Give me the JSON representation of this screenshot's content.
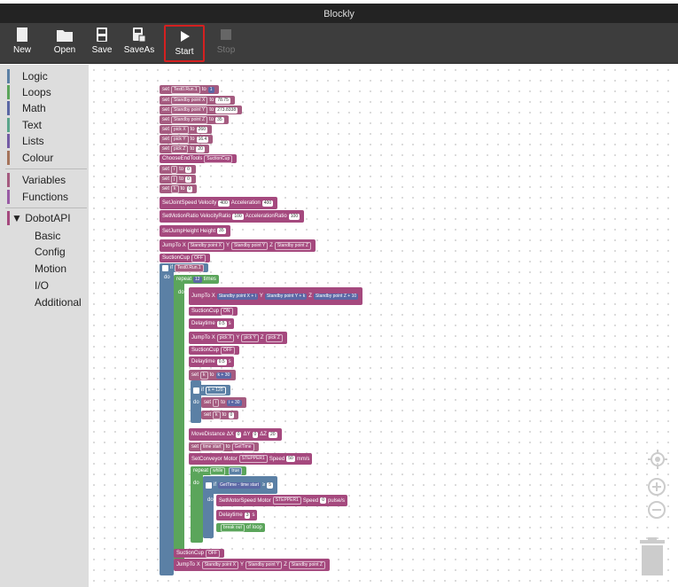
{
  "window": {
    "title": "Blockly"
  },
  "toolbar": {
    "new": "New",
    "open": "Open",
    "save": "Save",
    "saveas": "SaveAs",
    "start": "Start",
    "stop": "Stop"
  },
  "sidebar": {
    "logic": "Logic",
    "loops": "Loops",
    "math": "Math",
    "text": "Text",
    "lists": "Lists",
    "colour": "Colour",
    "variables": "Variables",
    "functions": "Functions",
    "dobot": "▼ DobotAPI",
    "sub": {
      "basic": "Basic",
      "config": "Config",
      "motion": "Motion",
      "io": "I/O",
      "additional": "Additional"
    }
  },
  "colors": {
    "procedure": "#a5497e",
    "variable": "#a55b80",
    "math": "#5b67a5",
    "logic": "#5b80a5",
    "loops": "#5ba55b",
    "sidebar_logic": "#5b80a5",
    "sidebar_loops": "#5ba55b",
    "sidebar_math": "#5b67a5",
    "sidebar_text": "#5ba58c",
    "sidebar_lists": "#745ba5",
    "sidebar_colour": "#a5745b",
    "sidebar_variables": "#a55b80",
    "sidebar_functions": "#995ba5",
    "sidebar_dobot": "#a5497e"
  },
  "blocks": {
    "b1": {
      "set": "set",
      "var": "Test0.Run.1",
      "to": "to",
      "val": "1"
    },
    "b2": {
      "set": "set",
      "var": "Standby point X",
      "to": "to",
      "val": "78.75"
    },
    "b3": {
      "set": "set",
      "var": "Standby point Y",
      "to": "to",
      "val": "273.8338"
    },
    "b4": {
      "set": "set",
      "var": "Standby point Z",
      "to": "to",
      "val": "35"
    },
    "b5": {
      "set": "set",
      "var": "pick X",
      "to": "to",
      "val": "260"
    },
    "b6": {
      "set": "set",
      "var": "pick Y",
      "to": "to",
      "val": "16.4"
    },
    "b7": {
      "set": "set",
      "var": "pick Z",
      "to": "to",
      "val": "20"
    },
    "b8": {
      "label": "ChooseEndTools",
      "val": "SuctionCup"
    },
    "b9": {
      "set": "set",
      "var": "i",
      "to": "to",
      "val": "0"
    },
    "b10": {
      "set": "set",
      "var": "j",
      "to": "to",
      "val": "0"
    },
    "b11": {
      "set": "set",
      "var": "k",
      "to": "to",
      "val": "0"
    },
    "b12": {
      "label": "SetJointSpeed",
      "a": "Velocity",
      "av": "400",
      "b": "Acceleration",
      "bv": "400"
    },
    "b13": {
      "label": "SetMotionRatio",
      "a": "VelocityRatio",
      "av": "100",
      "b": "AccelerationRatio",
      "bv": "100"
    },
    "b14": {
      "label": "SetJumpHeight",
      "a": "Height",
      "av": "35"
    },
    "b15": {
      "label": "JumpTo",
      "x": "X",
      "xv": "Standby point X",
      "y": "Y",
      "yv": "Standby point Y",
      "z": "Z",
      "zv": "Standby point Z"
    },
    "b16": {
      "label": "SuctionCup",
      "val": "OFF"
    },
    "if1": {
      "if": "if",
      "cond": "Test0.Run.1",
      "do": "do"
    },
    "rep": {
      "repeat": "repeat",
      "count": "12",
      "times": "times",
      "do": "do"
    },
    "j2": {
      "label": "JumpTo",
      "x": "X",
      "xv": "Standby point X",
      "op1": "+",
      "v1": "i",
      "y": "Y",
      "yv": "Standby point Y",
      "op2": "+",
      "v2": "k",
      "z": "Z",
      "zv": "Standby point Z",
      "op3": "+",
      "v3": "10"
    },
    "sc1": {
      "label": "SuctionCup",
      "val": "ON"
    },
    "d1": {
      "label": "Delaytime",
      "val": "0.5",
      "unit": "s"
    },
    "j3": {
      "label": "JumpTo",
      "x": "X",
      "xv": "pick X",
      "y": "Y",
      "yv": "pick Y",
      "z": "Z",
      "zv": "pick Z"
    },
    "sc2": {
      "label": "SuctionCup",
      "val": "OFF"
    },
    "d2": {
      "label": "Delaytime",
      "val": "0.5",
      "unit": "s"
    },
    "sk": {
      "set": "set",
      "var": "k",
      "to": "to",
      "a": "k",
      "op": "+",
      "b": "30"
    },
    "if2": {
      "if": "if",
      "a": "k",
      "op": "=",
      "b": "120",
      "do": "do"
    },
    "si": {
      "set": "set",
      "var": "i",
      "to": "to",
      "a": "i",
      "op": "+",
      "b": "30"
    },
    "sk0": {
      "set": "set",
      "var": "k",
      "to": "to",
      "val": "0"
    },
    "md": {
      "label": "MoveDistance",
      "dx": "ΔX",
      "dxv": "0",
      "dy": "ΔY",
      "dyv": "0",
      "dz": "ΔZ",
      "dzv": "20"
    },
    "st": {
      "set": "set",
      "var": "time start",
      "to": "to",
      "val": "GetTime"
    },
    "cv": {
      "label": "SetConveyor",
      "motor": "Motor",
      "motorv": "STEPPER1",
      "speed": "Speed",
      "speedv": "50",
      "unit": "mm/s"
    },
    "rw": {
      "repeat": "repeat",
      "mode": "while",
      "val": "true",
      "do": "do"
    },
    "if3": {
      "if": "if",
      "a": "GetTime",
      "op": "-",
      "b": "time start",
      "op2": "≥",
      "c": "5",
      "do": "do"
    },
    "ms": {
      "label": "SetMotorSpeed",
      "motor": "Motor",
      "motorv": "STEPPER1",
      "speed": "Speed",
      "speedv": "0",
      "unit": "pulse/s"
    },
    "d3": {
      "label": "Delaytime",
      "val": "3",
      "unit": "s"
    },
    "brk": {
      "val": "break out",
      "of": "of loop"
    },
    "sc3": {
      "label": "SuctionCup",
      "val": "OFF"
    },
    "j4": {
      "label": "JumpTo",
      "x": "X",
      "xv": "Standby point X",
      "y": "Y",
      "yv": "Standby point Y",
      "z": "Z",
      "zv": "Standby point Z"
    }
  }
}
